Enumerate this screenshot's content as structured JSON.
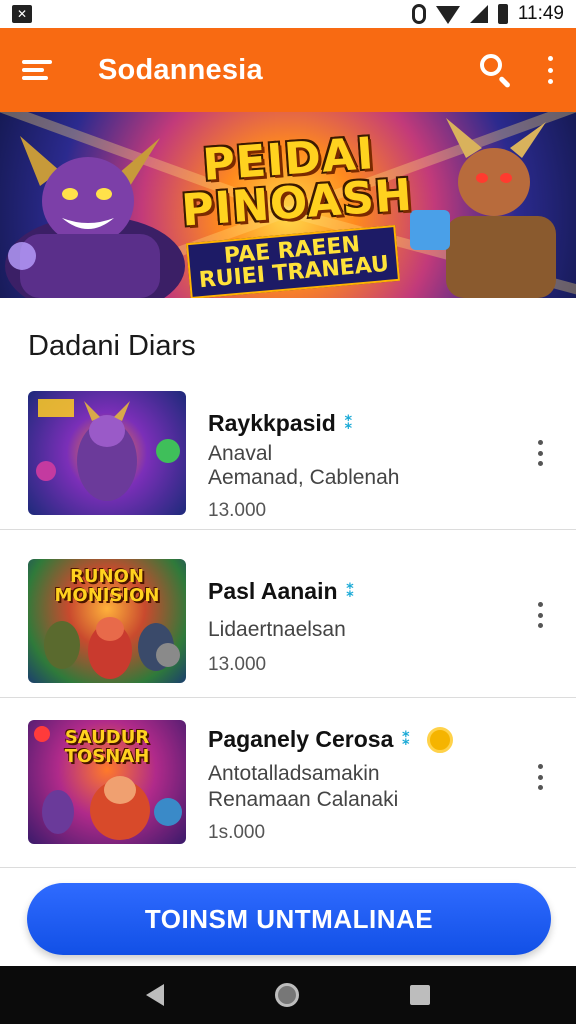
{
  "status_bar": {
    "time": "11:49",
    "left_icon": "notification-icon",
    "icons": [
      "vibrate-icon",
      "wifi-icon",
      "signal-icon",
      "battery-icon"
    ]
  },
  "app_bar": {
    "title": "Sodannesia",
    "menu_icon": "menu-icon",
    "search_icon": "search-icon",
    "more_icon": "more-vert-icon",
    "color": "#f86a12"
  },
  "banner": {
    "title": "PEIDAI PINOASH",
    "subtitle": "PAE RAEEN RUIEI TRANEAU"
  },
  "section": {
    "title": "Dadani Diars"
  },
  "games": [
    {
      "name": "Raykkpasid",
      "line1": "Anaval",
      "line2": "Aemanad, Cablenah",
      "price": "13.000",
      "thumb_text": "",
      "badge_coin": false
    },
    {
      "name": "Pasl Aanain",
      "line1": "",
      "line2": "Lidaertnaelsan",
      "price": "13.000",
      "thumb_text": "RUNON MONISION",
      "badge_coin": false
    },
    {
      "name": "Paganely Cerosa",
      "line1": "Antotalladsamakin",
      "line2": "Renamaan Calanaki",
      "price": "1s.000",
      "thumb_text": "SAUDUR TOSNAH",
      "badge_coin": true
    }
  ],
  "cta": {
    "label": "TOINSM UNTMALINAE",
    "color": "#1250e6"
  },
  "nav_bar": {
    "back_icon": "back-icon",
    "home_icon": "home-icon",
    "recents_icon": "recents-icon"
  }
}
